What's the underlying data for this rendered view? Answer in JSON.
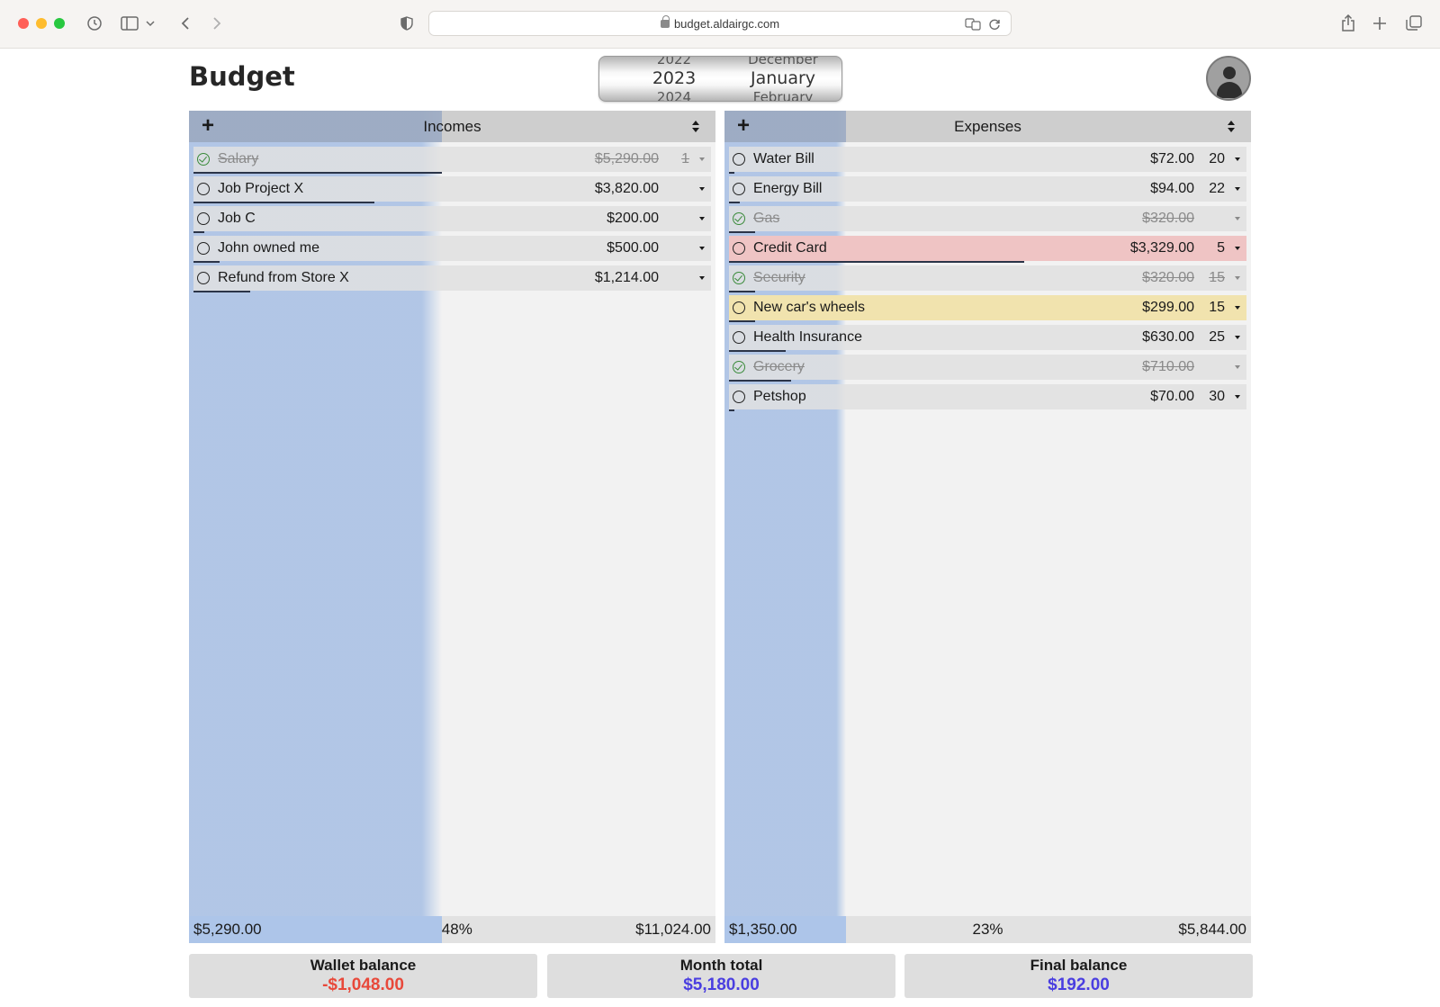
{
  "browser": {
    "url": "budget.aldairgc.com"
  },
  "page": {
    "title": "Budget"
  },
  "date_picker": {
    "years": {
      "prev": "2022",
      "current": "2023",
      "next": "2024"
    },
    "months": {
      "prev": "December",
      "current": "January",
      "next": "February"
    }
  },
  "incomes": {
    "title": "Incomes",
    "add_label": "+",
    "progress_fraction": 0.48,
    "rows": [
      {
        "name": "Salary",
        "amount": "$5,290.00",
        "day": "1",
        "done": true,
        "bar_fraction": 0.48
      },
      {
        "name": "Job Project X",
        "amount": "$3,820.00",
        "day": "",
        "done": false,
        "bar_fraction": 0.35
      },
      {
        "name": "Job C",
        "amount": "$200.00",
        "day": "",
        "done": false,
        "bar_fraction": 0.02
      },
      {
        "name": "John owned me",
        "amount": "$500.00",
        "day": "",
        "done": false,
        "bar_fraction": 0.05
      },
      {
        "name": "Refund from Store X",
        "amount": "$1,214.00",
        "day": "",
        "done": false,
        "bar_fraction": 0.11
      }
    ],
    "footer": {
      "done_total": "$5,290.00",
      "percent": "48%",
      "total": "$11,024.00"
    }
  },
  "expenses": {
    "title": "Expenses",
    "add_label": "+",
    "progress_fraction": 0.23,
    "rows": [
      {
        "name": "Water Bill",
        "amount": "$72.00",
        "day": "20",
        "done": false,
        "bar_fraction": 0.01,
        "highlight": ""
      },
      {
        "name": "Energy Bill",
        "amount": "$94.00",
        "day": "22",
        "done": false,
        "bar_fraction": 0.02,
        "highlight": ""
      },
      {
        "name": "Gas",
        "amount": "$320.00",
        "day": "",
        "done": true,
        "bar_fraction": 0.05,
        "highlight": ""
      },
      {
        "name": "Credit Card",
        "amount": "$3,329.00",
        "day": "5",
        "done": false,
        "bar_fraction": 0.57,
        "highlight": "red"
      },
      {
        "name": "Security",
        "amount": "$320.00",
        "day": "15",
        "done": true,
        "bar_fraction": 0.05,
        "highlight": ""
      },
      {
        "name": "New car's wheels",
        "amount": "$299.00",
        "day": "15",
        "done": false,
        "bar_fraction": 0.05,
        "highlight": "yellow"
      },
      {
        "name": "Health Insurance",
        "amount": "$630.00",
        "day": "25",
        "done": false,
        "bar_fraction": 0.11,
        "highlight": ""
      },
      {
        "name": "Grocery",
        "amount": "$710.00",
        "day": "",
        "done": true,
        "bar_fraction": 0.12,
        "highlight": ""
      },
      {
        "name": "Petshop",
        "amount": "$70.00",
        "day": "30",
        "done": false,
        "bar_fraction": 0.01,
        "highlight": ""
      }
    ],
    "footer": {
      "done_total": "$1,350.00",
      "percent": "23%",
      "total": "$5,844.00"
    }
  },
  "summary": {
    "wallet": {
      "label": "Wallet balance",
      "value": "-$1,048.00",
      "color": "#e8483a"
    },
    "month": {
      "label": "Month total",
      "value": "$5,180.00",
      "color": "#4a3ee0"
    },
    "final": {
      "label": "Final balance",
      "value": "$192.00",
      "color": "#4a3ee0"
    }
  }
}
